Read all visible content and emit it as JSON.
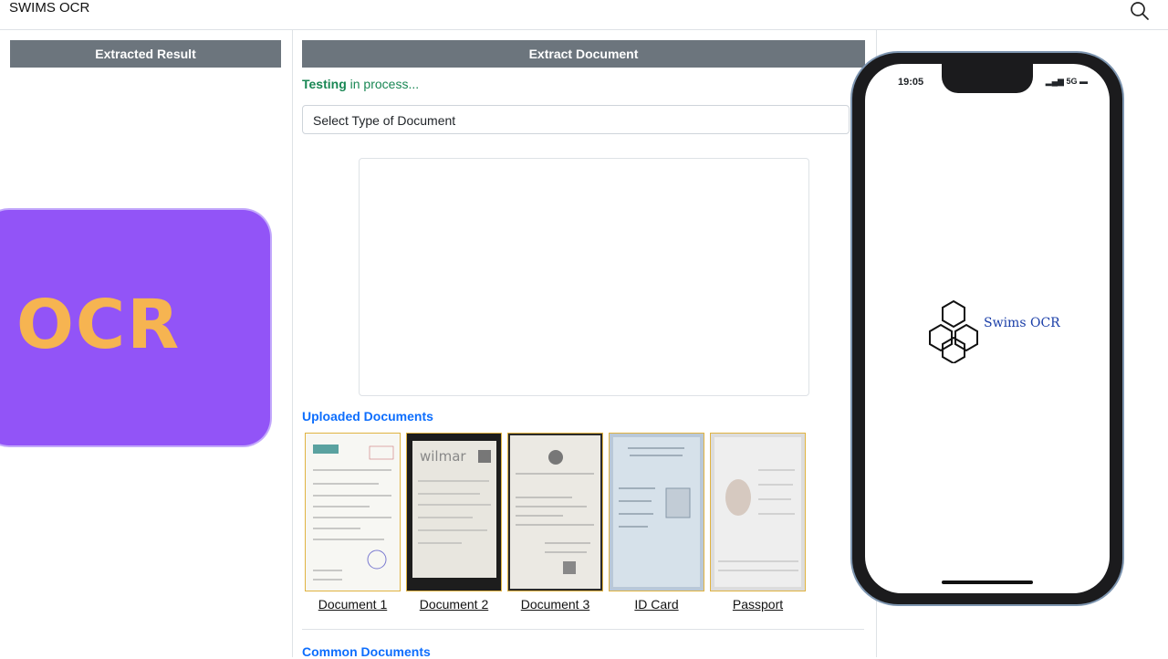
{
  "app": {
    "title": "SWIMS OCR"
  },
  "left_panel": {
    "header": "Extracted Result"
  },
  "main": {
    "header": "Extract Document",
    "status_strong": "Testing",
    "status_rest": " in process...",
    "select_value": "Select Type of Document",
    "uploaded_title": "Uploaded Documents",
    "uploaded": [
      {
        "label": "Document 1"
      },
      {
        "label": "Document 2"
      },
      {
        "label": "Document 3"
      },
      {
        "label": "ID Card"
      },
      {
        "label": "Passport"
      }
    ],
    "common_title": "Common Documents"
  },
  "overlay": {
    "ocr_text": "OCR"
  },
  "phone": {
    "time": "19:05",
    "network": "5G",
    "app_name": "Swims OCR"
  },
  "colors": {
    "header_bg": "#6c757d",
    "status_green": "#198754",
    "link_blue": "#0d6efd",
    "ocr_purple": "#9254f7",
    "ocr_orange": "#f6b451"
  },
  "icons": [
    "search-icon",
    "app-cubes-icon",
    "signal-icon",
    "battery-icon"
  ]
}
